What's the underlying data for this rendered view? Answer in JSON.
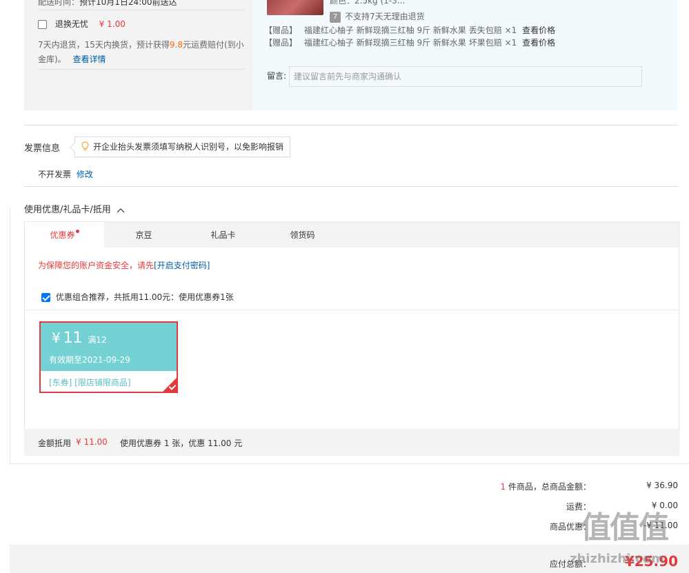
{
  "service": {
    "delivery_time_prefix": "配送时间：",
    "delivery_time": "预计10月1日24:00前送达",
    "worry_free_label": "退换无忧",
    "worry_free_price": "¥ 1.00",
    "desc_part1": "7天内退货，15天内换货，预计获得",
    "desc_amount": "9.8",
    "desc_part2": "元运费赔付(到小",
    "desc_line2": "金库)。",
    "details_link": "查看详情"
  },
  "goods": {
    "attr_text": "颜色：2.5kg (1-3...",
    "no_return_badge": "7",
    "no_return_text": "不支持7天无理由退货",
    "gifts": [
      {
        "tag": "【赠品】",
        "name": "福建红心柚子 新鲜现摘三红柚 9斤 新鲜水果 丢失包赔",
        "qty": "×1",
        "link": "查看价格"
      },
      {
        "tag": "【赠品】",
        "name": "福建红心柚子 新鲜现摘三红柚 9斤 新鲜水果 坏果包赔",
        "qty": "×1",
        "link": "查看价格"
      }
    ],
    "message_label": "留言:",
    "message_placeholder": "建议留言前先与商家沟通确认"
  },
  "invoice": {
    "title": "发票信息",
    "tip": "开企业抬头发票须填写纳税人识别号，以免影响报销",
    "status": "不开发票",
    "modify_link": "修改"
  },
  "discount": {
    "title": "使用优惠/礼品卡/抵用",
    "tabs": [
      "优惠券",
      "京豆",
      "礼品卡",
      "领货码"
    ],
    "security_notice": "为保障您的账户资金安全，请先",
    "security_link": "[开启支付密码]",
    "combo_text": "优惠组合推荐，共抵用11.00元：使用优惠券1张",
    "coupon": {
      "symbol": "¥",
      "amount": "11",
      "condition": "满12",
      "validity": "有效期至2021-09-29",
      "scope": "[东券] [限店铺限商品]"
    },
    "summary_label": "金额抵用",
    "summary_amount": "¥ 11.00",
    "summary_text": "使用优惠券 1 张，优惠 11.00 元"
  },
  "totals": {
    "count": "1",
    "count_suffix": " 件商品，总商品金额：",
    "goods_amount": "¥ 36.90",
    "shipping_label": "运费：",
    "shipping_amount": "¥ 0.00",
    "discount_label": "商品优惠：",
    "discount_amount": "-¥ 11.00",
    "pay_label": "应付总额：",
    "pay_amount": "¥25.90"
  },
  "watermark": {
    "glyphs": "值值值",
    "site": "zhizhizhi.com"
  },
  "colors": {
    "accent_red": "#e4393c",
    "link_blue": "#005ea7",
    "coupon_teal": "#74d2d4",
    "goods_panel_bg": "#f3fafe"
  }
}
